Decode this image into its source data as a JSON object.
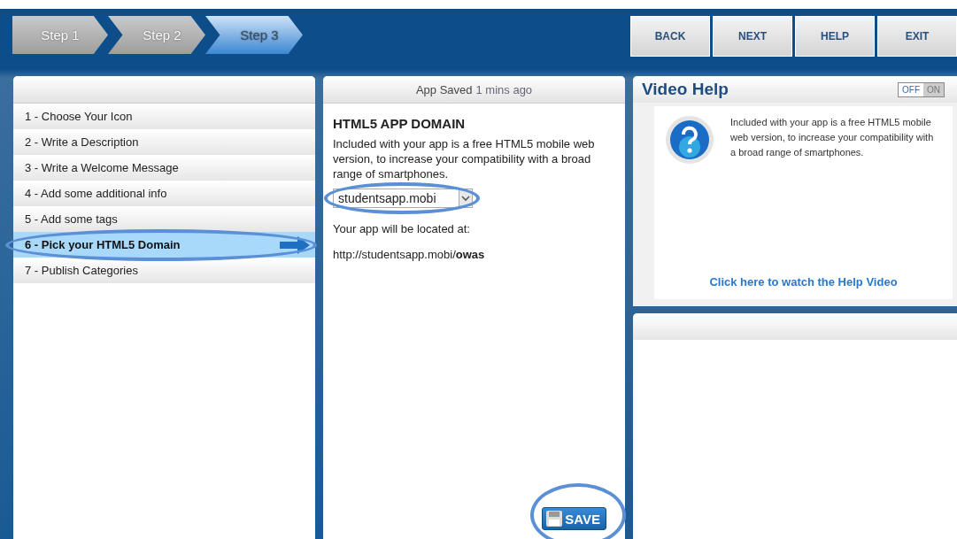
{
  "steps": [
    {
      "label": "Step 1",
      "selected": false
    },
    {
      "label": "Step 2",
      "selected": false
    },
    {
      "label": "Step 3",
      "selected": true
    }
  ],
  "nav_buttons": [
    "BACK",
    "NEXT",
    "HELP",
    "EXIT"
  ],
  "sidebar": {
    "items": [
      {
        "label": "1 - Choose Your Icon",
        "selected": false
      },
      {
        "label": "2 - Write a Description",
        "selected": false
      },
      {
        "label": "3 - Write a Welcome Message",
        "selected": false
      },
      {
        "label": "4 - Add some additional info",
        "selected": false
      },
      {
        "label": "5 - Add some tags",
        "selected": false
      },
      {
        "label": "6 - Pick your HTML5 Domain",
        "selected": true
      },
      {
        "label": "7 - Publish Categories",
        "selected": false
      }
    ]
  },
  "editor": {
    "status_label": "App Saved",
    "status_time": "1 mins ago",
    "heading": "HTML5 APP DOMAIN",
    "description": "Included with your app is a free HTML5 mobile web version, to increase your compatibility with a broad range of smartphones.",
    "domain_select": {
      "value": "studentsapp.mobi"
    },
    "location_label": "Your app will be located at:",
    "location_url": "http://studentsapp.mobi/**owas**",
    "save_button": "SAVE"
  },
  "video_help": {
    "title": "Video Help",
    "toggle": {
      "off_label": "OFF",
      "on_label": "ON",
      "on": false
    },
    "text": "Included with your app is a free HTML5 mobile web version, to increase your compatibility with a broad range of smartphones.",
    "link": "Click here to watch the Help Video"
  }
}
